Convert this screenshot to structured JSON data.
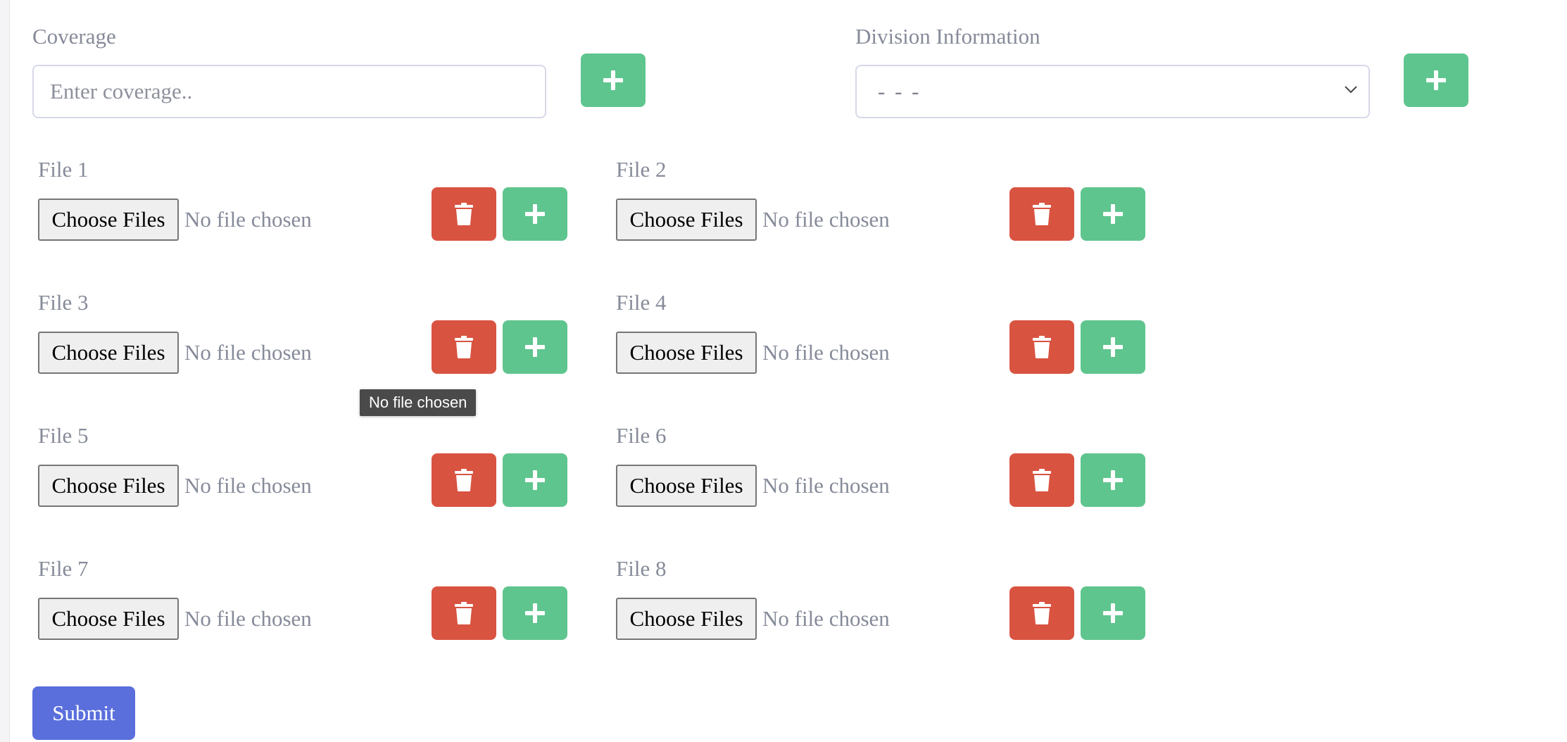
{
  "coverage": {
    "label": "Coverage",
    "placeholder": "Enter coverage..",
    "add_icon": "plus-icon"
  },
  "division": {
    "label": "Division Information",
    "selected": "- - -",
    "add_icon": "plus-icon"
  },
  "files": [
    {
      "label": "File 1",
      "button": "Choose Files",
      "status": "No file chosen"
    },
    {
      "label": "File 2",
      "button": "Choose Files",
      "status": "No file chosen"
    },
    {
      "label": "File 3",
      "button": "Choose Files",
      "status": "No file chosen"
    },
    {
      "label": "File 4",
      "button": "Choose Files",
      "status": "No file chosen"
    },
    {
      "label": "File 5",
      "button": "Choose Files",
      "status": "No file chosen"
    },
    {
      "label": "File 6",
      "button": "Choose Files",
      "status": "No file chosen"
    },
    {
      "label": "File 7",
      "button": "Choose Files",
      "status": "No file chosen"
    },
    {
      "label": "File 8",
      "button": "Choose Files",
      "status": "No file chosen"
    }
  ],
  "file_row_icons": {
    "delete": "trash-icon",
    "add": "plus-icon"
  },
  "tooltip": "No file chosen",
  "submit_label": "Submit",
  "colors": {
    "green": "#5fc58e",
    "red": "#d95341",
    "submit": "#5a6fdc",
    "label": "#868b99"
  }
}
